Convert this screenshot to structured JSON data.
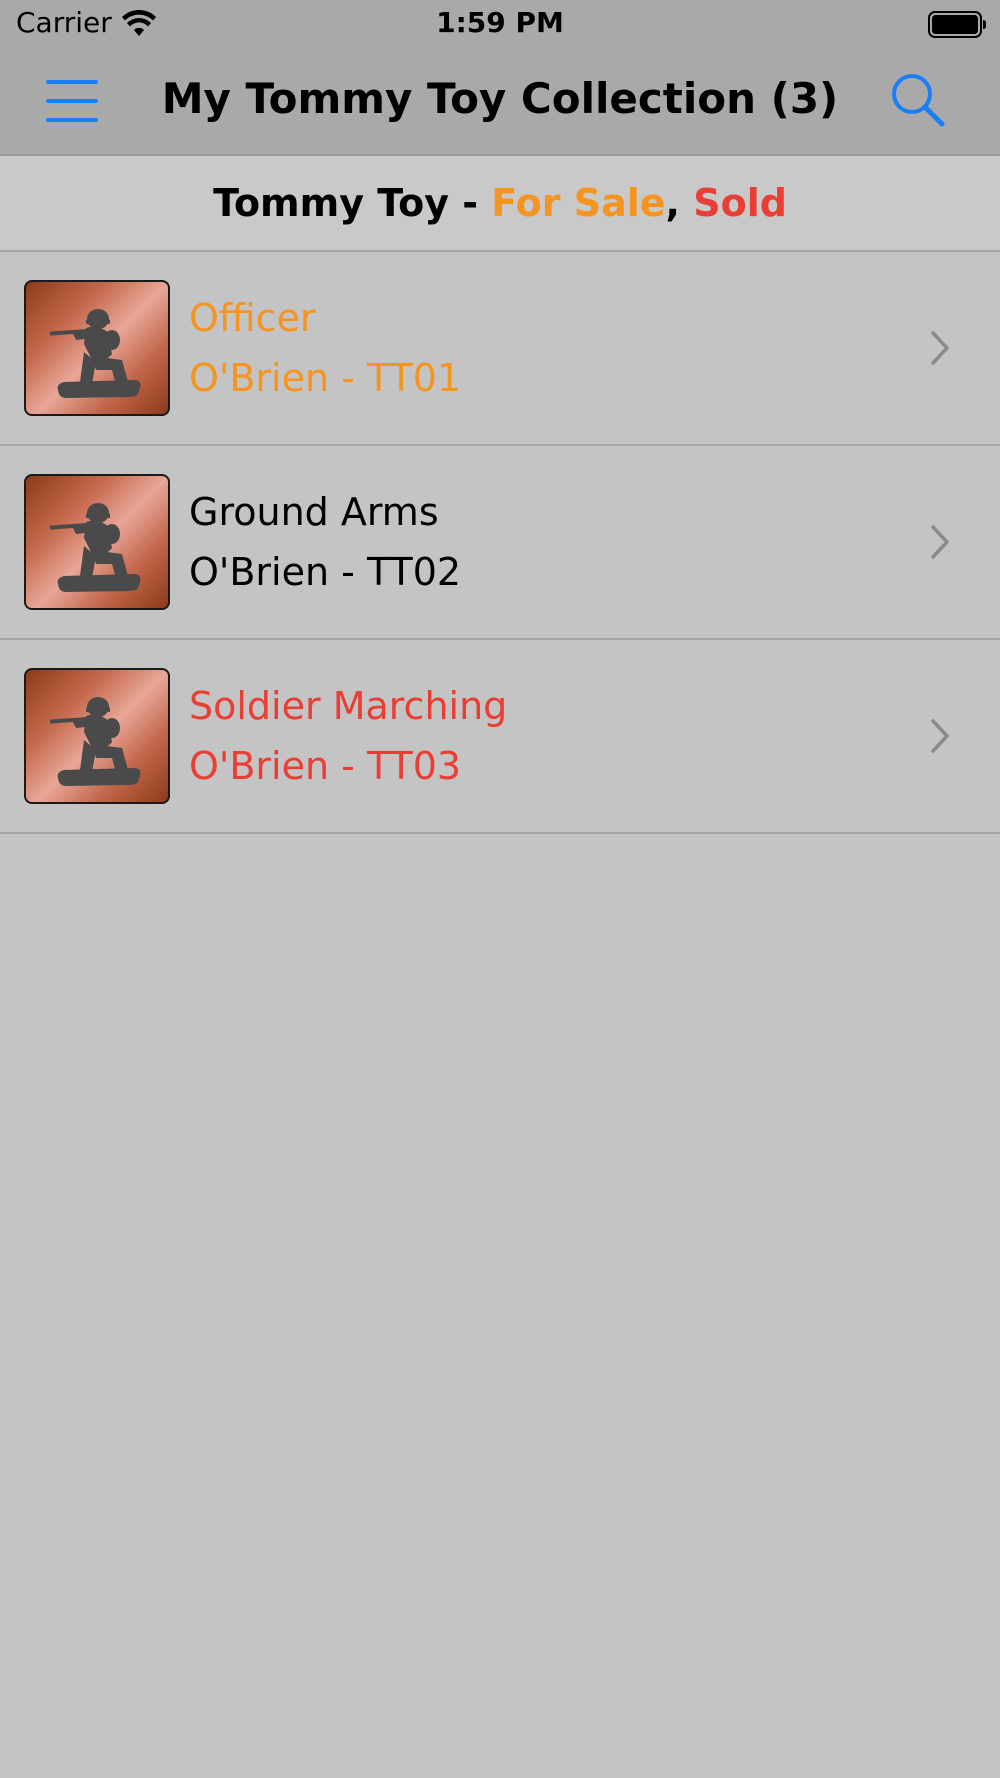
{
  "status_bar": {
    "carrier": "Carrier",
    "time": "1:59 PM",
    "wifi_icon": "wifi-icon",
    "battery_icon": "battery-icon"
  },
  "nav": {
    "title": "My Tommy Toy Collection (3)",
    "menu_icon": "hamburger-menu-icon",
    "search_icon": "search-icon",
    "accent_color": "#1a7ef5"
  },
  "section_header": {
    "prefix": "Tommy Toy - ",
    "for_sale": "For Sale",
    "separator": ", ",
    "sold": "Sold",
    "for_sale_color": "#f5941e",
    "sold_color": "#ea3d33"
  },
  "items": [
    {
      "title": "Officer",
      "subtitle": "O'Brien - TT01",
      "status": "for-sale",
      "color": "#f5941e",
      "thumbnail": "toy-soldier-image",
      "chevron": "chevron-right-icon"
    },
    {
      "title": "Ground Arms",
      "subtitle": "O'Brien - TT02",
      "status": "owned",
      "color": "#000000",
      "thumbnail": "toy-soldier-image",
      "chevron": "chevron-right-icon"
    },
    {
      "title": "Soldier Marching",
      "subtitle": "O'Brien - TT03",
      "status": "sold",
      "color": "#ea3d33",
      "thumbnail": "toy-soldier-image",
      "chevron": "chevron-right-icon"
    }
  ]
}
